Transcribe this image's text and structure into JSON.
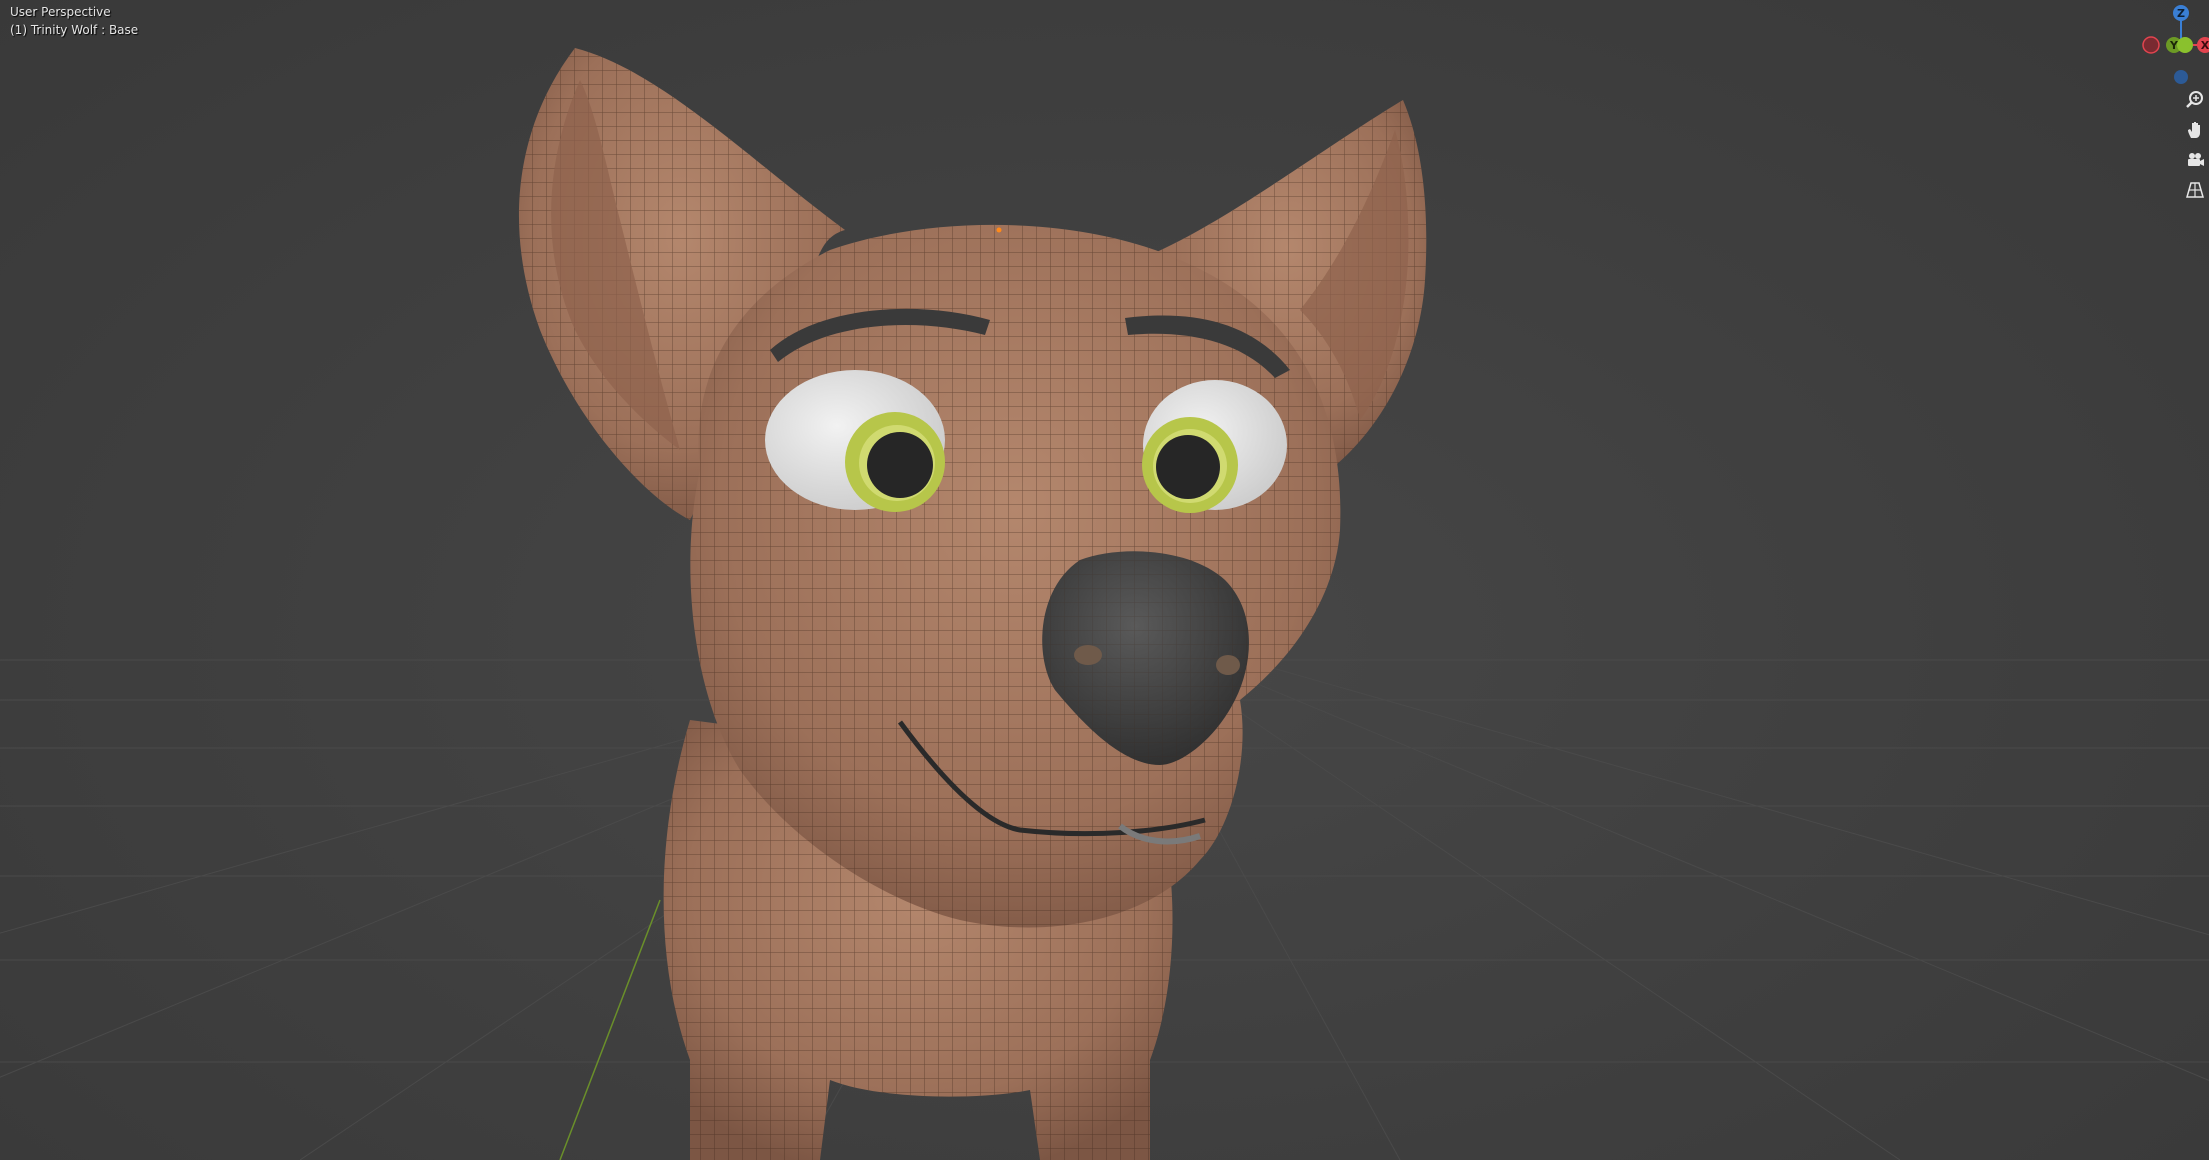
{
  "viewport": {
    "view_name": "User Perspective",
    "object_info": "(1) Trinity Wolf : Base"
  },
  "gizmo": {
    "z_label": "Z",
    "y_label": "Y",
    "x_label": "X",
    "colors": {
      "x": "#e2444f",
      "y": "#8ac12d",
      "z": "#3a7fd5"
    }
  },
  "nav_tools": [
    {
      "name": "zoom-icon"
    },
    {
      "name": "pan-hand-icon"
    },
    {
      "name": "camera-icon"
    },
    {
      "name": "perspective-grid-icon"
    }
  ],
  "model": {
    "skin_color": "#a87c63",
    "eye_iris_color": "#b7c64a",
    "nose_color": "#3b3b3b"
  }
}
